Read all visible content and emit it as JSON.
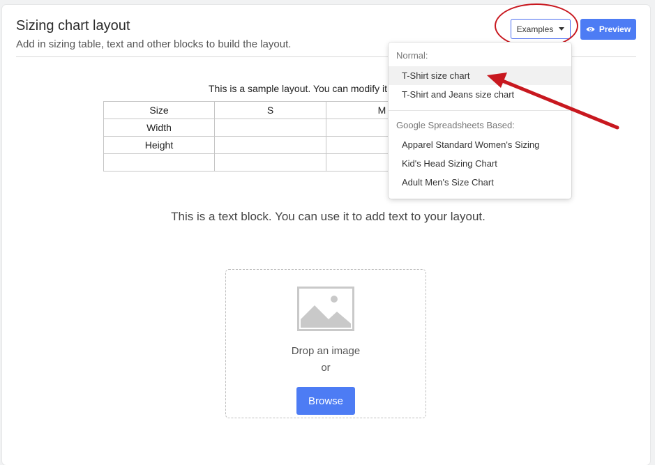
{
  "header": {
    "title": "Sizing chart layout",
    "subtitle": "Add in sizing table, text and other blocks to build the layout.",
    "examples_label": "Examples",
    "preview_label": "Preview"
  },
  "sample": {
    "caption": "This is a sample layout. You can modify it a",
    "table": {
      "header": [
        "Size",
        "S",
        "M",
        ""
      ],
      "rows": [
        [
          "Width",
          "",
          "",
          ""
        ],
        [
          "Height",
          "",
          "",
          ""
        ],
        [
          "",
          "",
          "",
          ""
        ]
      ]
    }
  },
  "text_block": "This is a text block. You can use it to add text to your layout.",
  "dropzone": {
    "drop_text": "Drop an image",
    "or_text": "or",
    "browse_label": "Browse"
  },
  "examples_menu": {
    "normal_header": "Normal:",
    "normal_items": [
      "T-Shirt size chart",
      "T-Shirt and Jeans size chart"
    ],
    "sheets_header": "Google Spreadsheets Based:",
    "sheets_items": [
      "Apparel Standard Women's Sizing",
      "Kid's Head Sizing Chart",
      "Adult Men's Size Chart"
    ]
  },
  "colors": {
    "accent": "#4d7cf4",
    "annotation": "#c8181f"
  }
}
